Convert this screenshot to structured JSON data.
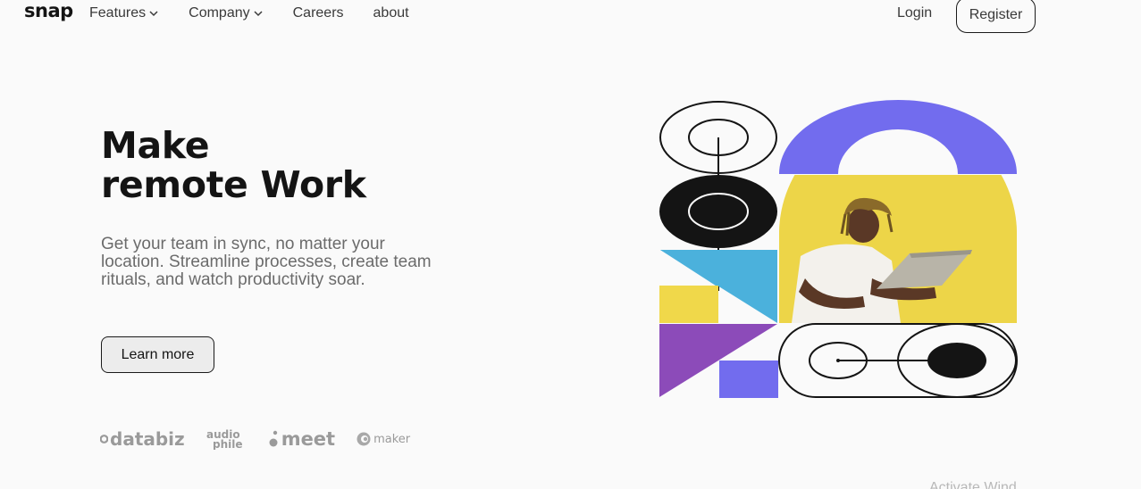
{
  "brand": {
    "logo_text": "snap"
  },
  "nav": {
    "items": [
      {
        "label": "Features",
        "has_dropdown": true
      },
      {
        "label": "Company",
        "has_dropdown": true
      },
      {
        "label": "Careers",
        "has_dropdown": false
      },
      {
        "label": "about",
        "has_dropdown": false
      }
    ],
    "login_label": "Login",
    "register_label": "Register"
  },
  "hero": {
    "title_line1": "Make",
    "title_line2": "remote Work",
    "description": "Get your team in sync, no matter your location. Streamline processes, create team rituals, and watch productivity soar.",
    "cta_label": "Learn more"
  },
  "clients": [
    {
      "name": "databiz",
      "icon": "databiz-icon"
    },
    {
      "name": "audiophile",
      "icon": "audiophile-logo"
    },
    {
      "name": "meet",
      "icon": "meet-icon"
    },
    {
      "name": "maker",
      "icon": "maker-icon"
    }
  ],
  "colors": {
    "text_dark": "#141414",
    "text_muted": "#6b6b6b",
    "accent_purple": "#726cee",
    "accent_yellow": "#f0d84a",
    "accent_blue": "#4bb1dc",
    "accent_violet": "#8c4bb9"
  },
  "watermark_text": "Activate Wind"
}
